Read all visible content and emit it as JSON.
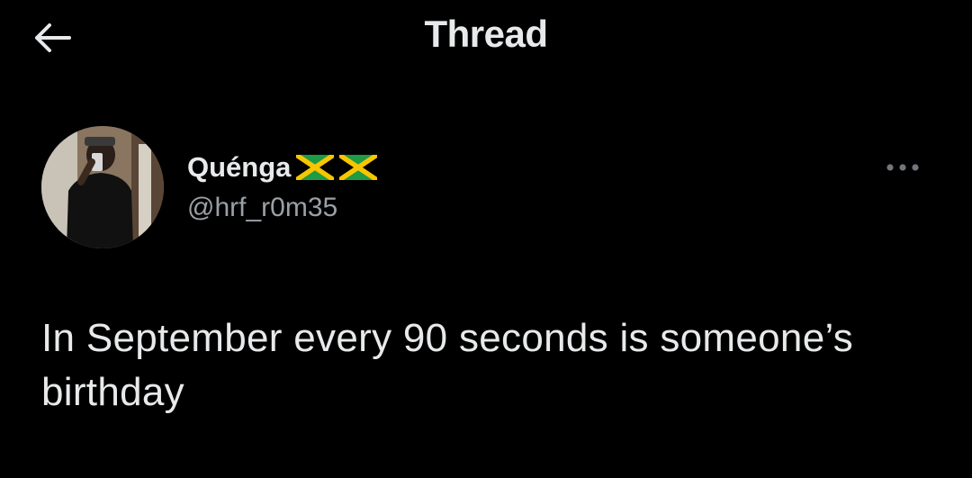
{
  "header": {
    "title": "Thread",
    "back_icon": "arrow-left-icon"
  },
  "tweet": {
    "display_name": "Quénga",
    "flag_icons": [
      "jamaica-flag-icon",
      "jamaica-flag-icon"
    ],
    "handle": "@hrf_r0m35",
    "more_icon": "more-horizontal-icon",
    "text": "In September every 90 seconds is someone’s birthday"
  },
  "colors": {
    "background": "#000000",
    "primary_text": "#e7e9ea",
    "secondary_text": "#9ba0a5"
  }
}
